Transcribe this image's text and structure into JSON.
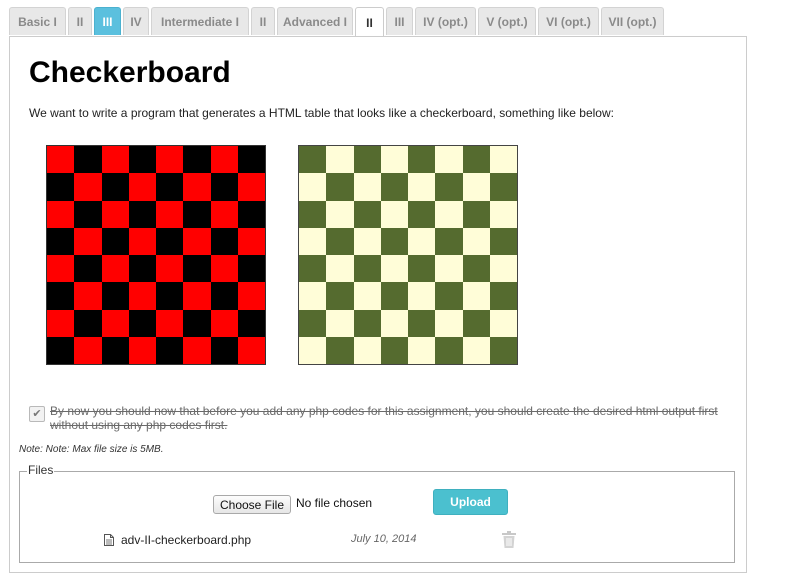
{
  "tabs": [
    {
      "label": "Basic I",
      "state": "normal"
    },
    {
      "label": "II",
      "state": "normal"
    },
    {
      "label": "III",
      "state": "active"
    },
    {
      "label": "IV",
      "state": "normal"
    },
    {
      "label": "Intermediate I",
      "state": "normal"
    },
    {
      "label": "II",
      "state": "normal"
    },
    {
      "label": "Advanced I",
      "state": "normal"
    },
    {
      "label": "II",
      "state": "current"
    },
    {
      "label": "III",
      "state": "normal"
    },
    {
      "label": "IV (opt.)",
      "state": "normal"
    },
    {
      "label": "V (opt.)",
      "state": "normal"
    },
    {
      "label": "VI (opt.)",
      "state": "normal"
    },
    {
      "label": "VII (opt.)",
      "state": "normal"
    }
  ],
  "page": {
    "title": "Checkerboard",
    "intro": "We want to write a program that generates a HTML table that looks like a checkerboard, something like below:"
  },
  "boards": {
    "size": 8,
    "red": {
      "color_a": "#ff0000",
      "color_b": "#000000"
    },
    "green": {
      "color_a": "#556b2f",
      "color_b": "#fffdd8"
    }
  },
  "task": {
    "checked": true,
    "text": "By now you should now that before you add any php codes for this assignment, you should create the desired html output first without using any php codes first."
  },
  "note": "Note: Note: Max file size is 5MB.",
  "files": {
    "legend": "Files",
    "choose_label": "Choose File",
    "no_file_text": "No file chosen",
    "upload_label": "Upload",
    "items": [
      {
        "name": "adv-II-checkerboard.php",
        "date": "July 10, 2014"
      }
    ]
  },
  "colors": {
    "accent": "#5bc0de",
    "upload": "#4bc0cf"
  }
}
